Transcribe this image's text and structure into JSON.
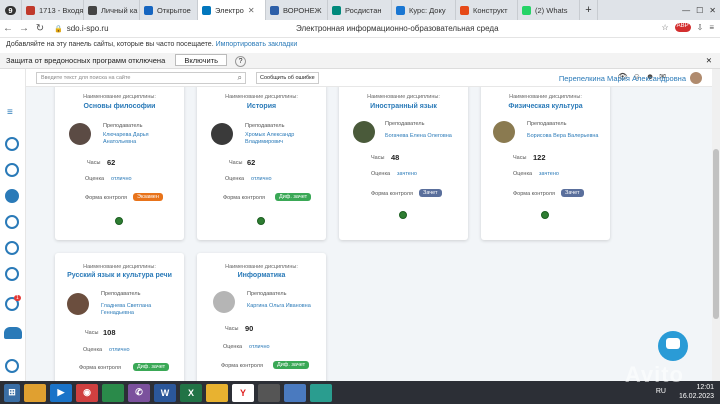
{
  "browser": {
    "tabs": [
      {
        "label": "1713 - Входя",
        "color": "#c0392b",
        "active": false
      },
      {
        "label": "Личный ка",
        "color": "#444",
        "active": false
      },
      {
        "label": "Открытое",
        "color": "#1565c0",
        "active": false
      },
      {
        "label": "Электро",
        "color": "#0277bd",
        "active": true
      },
      {
        "label": "ВОРОНЕЖ",
        "color": "#2d5fa8",
        "active": false
      },
      {
        "label": "Росдистан",
        "color": "#00897b",
        "active": false
      },
      {
        "label": "Курс: Доку",
        "color": "#1976d2",
        "active": false
      },
      {
        "label": "Конструкт",
        "color": "#e64a19",
        "active": false
      },
      {
        "label": "(2) Whats",
        "color": "#25d366",
        "active": false
      }
    ],
    "tab_count": "9",
    "url": "sdo.i-spo.ru",
    "page_title": "Электронная информационно-образовательная среда",
    "favbar_text": "Добавляйте на эту панель сайты, которые вы часто посещаете.",
    "favbar_link": "Импортировать закладки",
    "protection_text": "Защита от вредоносных программ отключена",
    "protection_button": "Включить",
    "protection_help": "?"
  },
  "site": {
    "search_placeholder": "Введите текст для поиска на сайте",
    "report_button": "Сообщить об ошибке",
    "user_name": "Перепелкина Мария Александровна"
  },
  "labels": {
    "discipline": "Наименование дисциплины:",
    "teacher": "Преподаватель",
    "hours": "Часы",
    "grade": "Оценка",
    "control": "Форма контроля"
  },
  "courses": [
    {
      "name": "Основы философии",
      "teacher": "Ключарева Дарья Анатольевна",
      "hours": "62",
      "grade": "отлично",
      "control": "Экзамен",
      "control_color": "#e8731a"
    },
    {
      "name": "История",
      "teacher": "Хромых Александр Владимирович",
      "hours": "62",
      "grade": "отлично",
      "control": "Диф. зачет",
      "control_color": "#3aa856"
    },
    {
      "name": "Иностранный язык",
      "teacher": "Богачева Елена Олеговна",
      "hours": "48",
      "grade": "зачтено",
      "control": "Зачет",
      "control_color": "#5a6f9c"
    },
    {
      "name": "Физическая культура",
      "teacher": "Борисова Вера Валерьевна",
      "hours": "122",
      "grade": "зачтено",
      "control": "Зачет",
      "control_color": "#5a6f9c"
    },
    {
      "name": "Русский язык и культура речи",
      "teacher": "Гладнева Светлана Геннадьевна",
      "hours": "108",
      "grade": "отлично",
      "control": "Диф. зачет",
      "control_color": "#3aa856"
    },
    {
      "name": "Информатика",
      "teacher": "Каргина Ольга Ивановна",
      "hours": "90",
      "grade": "отлично",
      "control": "Диф. зачет",
      "control_color": "#3aa856"
    }
  ],
  "notification_badge": "1",
  "taskbar": {
    "lang": "RU",
    "time": "12:01",
    "date": "16.02.2023"
  },
  "watermark": "Avito"
}
